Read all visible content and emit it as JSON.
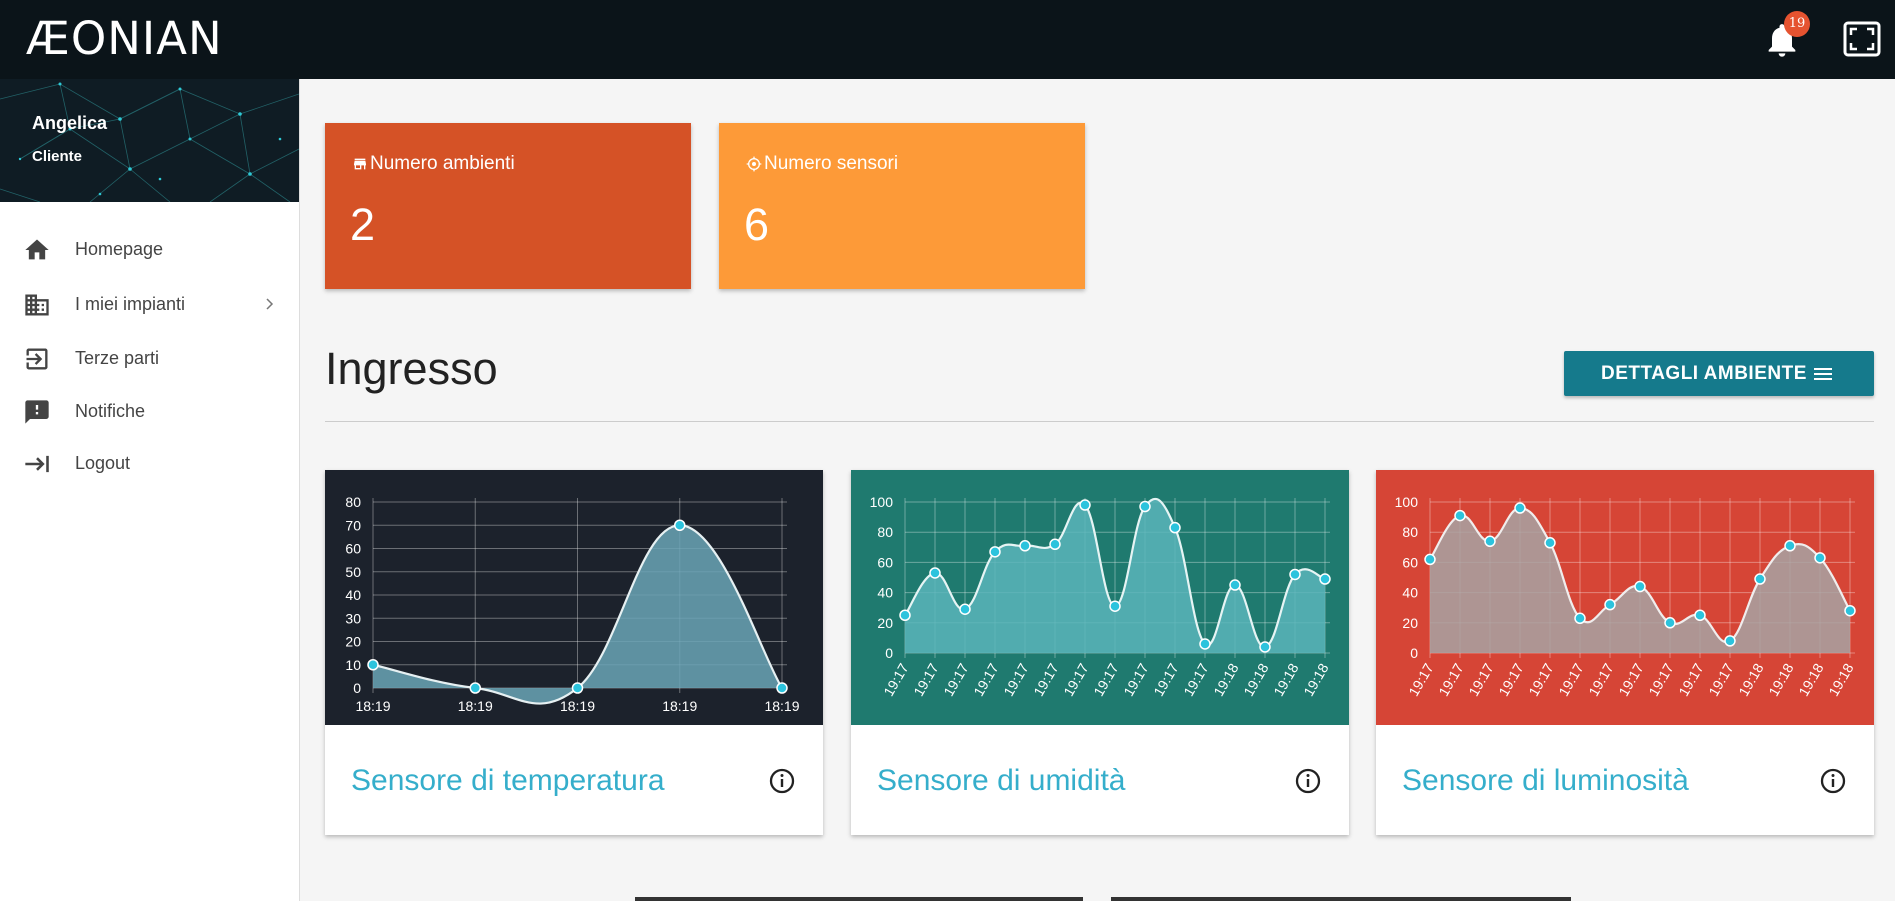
{
  "app": {
    "brand": "ÆONIAN",
    "notifications_count": "19"
  },
  "profile": {
    "name": "Angelica",
    "role": "Cliente"
  },
  "sidebar": {
    "items": [
      {
        "label": "Homepage",
        "icon": "home-icon"
      },
      {
        "label": "I miei impianti",
        "icon": "building-icon",
        "has_submenu": true
      },
      {
        "label": "Terze parti",
        "icon": "login-icon"
      },
      {
        "label": "Notifiche",
        "icon": "feedback-icon"
      },
      {
        "label": "Logout",
        "icon": "logout-icon"
      }
    ]
  },
  "stats": [
    {
      "label": "Numero ambienti",
      "value": "2",
      "icon": "store-icon",
      "color": "#d55226"
    },
    {
      "label": "Numero sensori",
      "value": "6",
      "icon": "sensor-icon",
      "color": "#fd9a38"
    }
  ],
  "section": {
    "title": "Ingresso",
    "button_label": "DETTAGLI AMBIENTE",
    "button_color": "#157a8c"
  },
  "sensors": [
    {
      "title": "Sensore di temperatura",
      "bg": "#1c222c"
    },
    {
      "title": "Sensore di umidità",
      "bg": "#1f7a6f"
    },
    {
      "title": "Sensore di luminosità",
      "bg": "#d64536"
    }
  ],
  "chart_data": [
    {
      "type": "area",
      "x": [
        "18:19",
        "18:19",
        "18:19",
        "18:19",
        "18:19"
      ],
      "values": [
        10,
        0,
        0,
        70,
        0
      ],
      "ylim": [
        0,
        80
      ],
      "yticks": [
        0,
        10,
        20,
        30,
        40,
        50,
        60,
        70,
        80
      ],
      "grid": true,
      "fill": "#6aa5b6",
      "line": "#e6f0f2",
      "point": "#2cc3dd"
    },
    {
      "type": "area",
      "x": [
        "19:17",
        "19:17",
        "19:17",
        "19:17",
        "19:17",
        "19:17",
        "19:17",
        "19:17",
        "19:17",
        "19:17",
        "19:17",
        "19:18",
        "19:18",
        "19:18",
        "19:18"
      ],
      "values": [
        25,
        53,
        29,
        67,
        71,
        72,
        98,
        31,
        97,
        83,
        6,
        45,
        4,
        52,
        49
      ],
      "ylim": [
        0,
        100
      ],
      "yticks": [
        0,
        20,
        40,
        60,
        80,
        100
      ],
      "grid": true,
      "fill": "#5bb5bb",
      "line": "#e6f4f4",
      "point": "#2cc3dd"
    },
    {
      "type": "area",
      "x": [
        "19:17",
        "19:17",
        "19:17",
        "19:17",
        "19:17",
        "19:17",
        "19:17",
        "19:17",
        "19:17",
        "19:17",
        "19:17",
        "19:18",
        "19:18",
        "19:18",
        "19:18"
      ],
      "values": [
        62,
        91,
        74,
        96,
        73,
        23,
        32,
        44,
        20,
        25,
        8,
        49,
        71,
        63,
        28
      ],
      "ylim": [
        0,
        100
      ],
      "yticks": [
        0,
        20,
        40,
        60,
        80,
        100
      ],
      "grid": true,
      "fill": "#a7a3a3",
      "line": "#f0eded",
      "point": "#2cc3dd"
    }
  ]
}
